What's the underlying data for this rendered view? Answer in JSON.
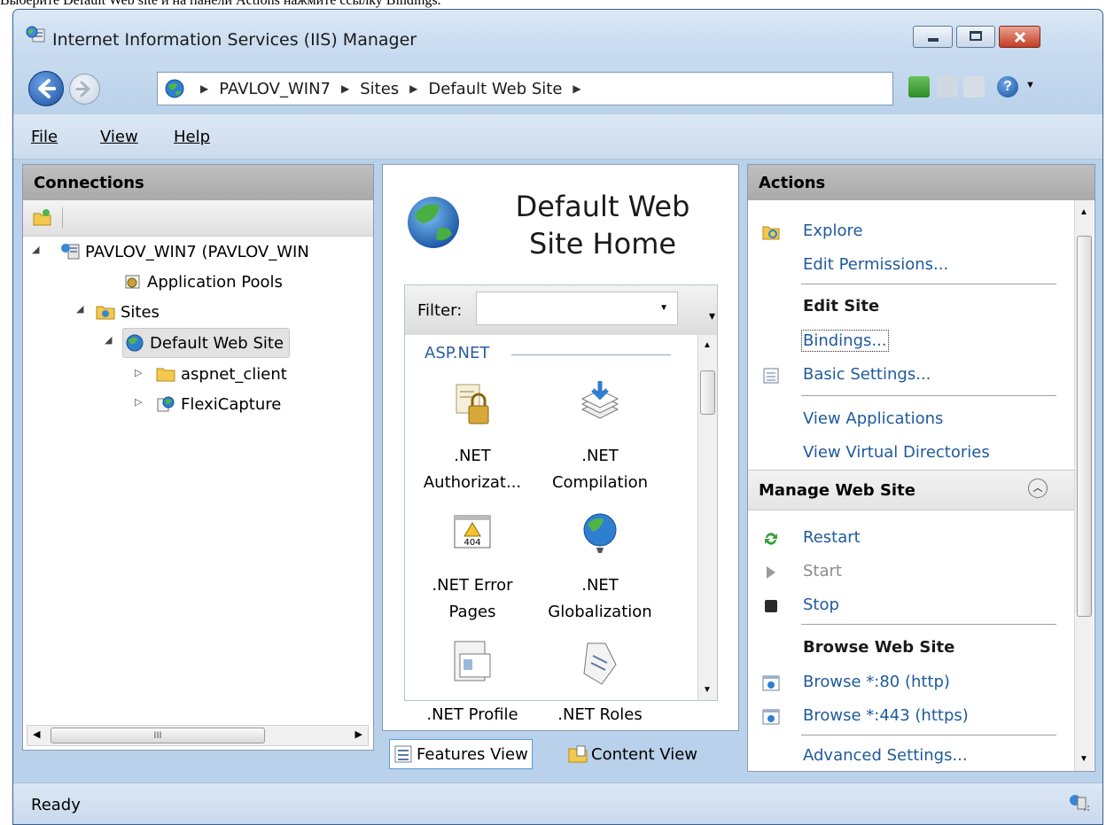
{
  "caption": "Выберите Default Web site и на панели Actions нажмите ссылку Bindings.",
  "window": {
    "title": "Internet Information Services (IIS) Manager"
  },
  "address": {
    "crumbs": [
      "PAVLOV_WIN7",
      "Sites",
      "Default Web Site"
    ]
  },
  "menu": {
    "file": "File",
    "view": "View",
    "help": "Help"
  },
  "connections": {
    "header": "Connections",
    "tree": {
      "server": "PAVLOV_WIN7 (PAVLOV_WIN",
      "app_pools": "Application Pools",
      "sites": "Sites",
      "default_site": "Default Web Site",
      "aspnet_client": "aspnet_client",
      "flexicapture": "FlexiCapture"
    },
    "scroll_thumb": "III"
  },
  "center": {
    "title_line1": "Default Web",
    "title_line2": "Site Home",
    "filter_label": "Filter:",
    "group": "ASP.NET",
    "features": [
      {
        "line1": ".NET",
        "line2": "Authorizat..."
      },
      {
        "line1": ".NET",
        "line2": "Compilation"
      },
      {
        "line1": ".NET Error",
        "line2": "Pages"
      },
      {
        "line1": ".NET",
        "line2": "Globalization"
      },
      {
        "line1": ".NET Profile",
        "line2": ""
      },
      {
        "line1": ".NET Roles",
        "line2": ""
      }
    ],
    "features_view": "Features View",
    "content_view": "Content View"
  },
  "actions": {
    "header": "Actions",
    "explore": "Explore",
    "edit_permissions": "Edit Permissions...",
    "edit_site": "Edit Site",
    "bindings": "Bindings...",
    "basic_settings": "Basic Settings...",
    "view_applications": "View Applications",
    "view_virtual_dirs": "View Virtual Directories",
    "manage_web_site": "Manage Web Site",
    "restart": "Restart",
    "start": "Start",
    "stop": "Stop",
    "browse_web_site": "Browse Web Site",
    "browse_http": "Browse *:80 (http)",
    "browse_https": "Browse *:443 (https)",
    "advanced_settings": "Advanced Settings..."
  },
  "status": {
    "text": "Ready"
  }
}
